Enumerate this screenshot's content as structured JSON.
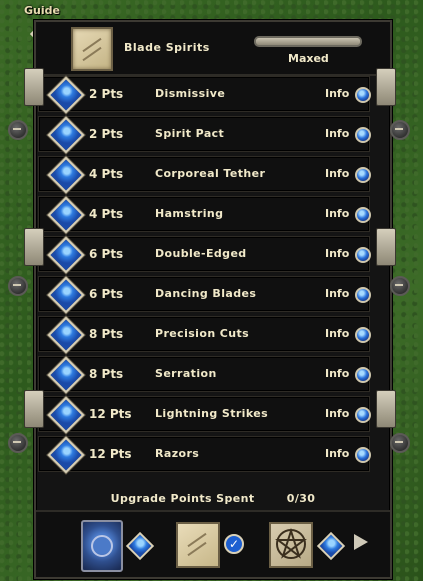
{
  "guide": {
    "label": "Guide"
  },
  "header": {
    "title": "Blade Spirits",
    "status": "Maxed",
    "progress": 1.0
  },
  "rows": [
    {
      "pts": "2 Pts",
      "name": "Dismissive",
      "info": "Info"
    },
    {
      "pts": "2 Pts",
      "name": "Spirit Pact",
      "info": "Info"
    },
    {
      "pts": "4 Pts",
      "name": "Corporeal Tether",
      "info": "Info"
    },
    {
      "pts": "4 Pts",
      "name": "Hamstring",
      "info": "Info"
    },
    {
      "pts": "6 Pts",
      "name": "Double-Edged",
      "info": "Info"
    },
    {
      "pts": "6 Pts",
      "name": "Dancing Blades",
      "info": "Info"
    },
    {
      "pts": "8 Pts",
      "name": "Precision Cuts",
      "info": "Info"
    },
    {
      "pts": "8 Pts",
      "name": "Serration",
      "info": "Info"
    },
    {
      "pts": "12 Pts",
      "name": "Lightning Strikes",
      "info": "Info"
    },
    {
      "pts": "12 Pts",
      "name": "Razors",
      "info": "Info"
    }
  ],
  "footer": {
    "label": "Upgrade Points Spent",
    "value": "0/30"
  },
  "colors": {
    "text": "#f1e9c9",
    "panel": "#141414",
    "gem": "#2e7be0"
  },
  "icons": {
    "scroll": "scroll-icon",
    "book": "spellbook-icon",
    "gem": "gem-icon",
    "check": "checkmark-icon",
    "pentagram": "pentagram-icon",
    "next": "arrow-right-icon"
  }
}
